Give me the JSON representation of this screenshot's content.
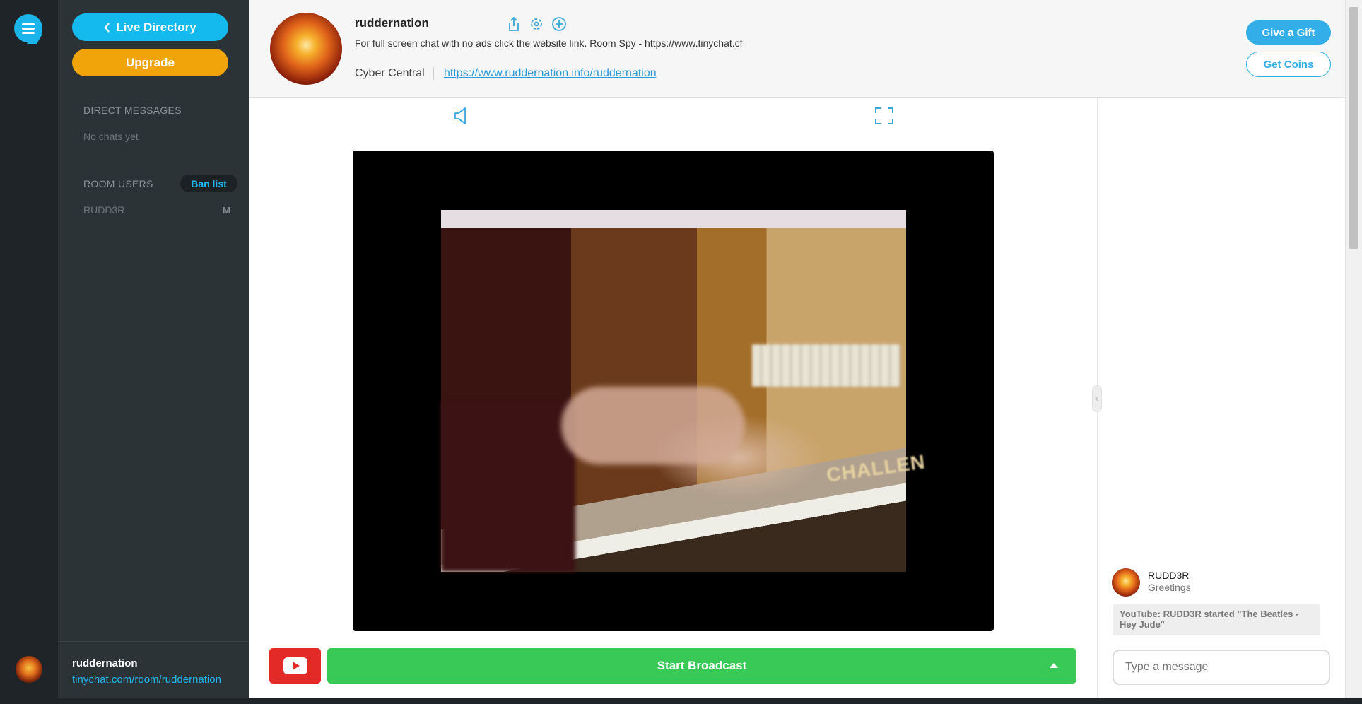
{
  "sidebar": {
    "live_directory_label": "Live Directory",
    "upgrade_label": "Upgrade",
    "direct_messages_heading": "DIRECT MESSAGES",
    "direct_messages_empty": "No chats yet",
    "room_users_heading": "ROOM USERS",
    "ban_list_label": "Ban list",
    "users": [
      {
        "name": "RUDD3R",
        "badge": "M"
      }
    ],
    "footer": {
      "username": "ruddernation",
      "room_url": "tinychat.com/room/ruddernation"
    }
  },
  "header": {
    "room_name": "ruddernation",
    "description": "For full screen chat with no ads click the website link. Room Spy - https://www.tinychat.cf",
    "category": "Cyber Central",
    "website": "https://www.ruddernation.info/ruddernation",
    "give_gift_label": "Give a Gift",
    "get_coins_label": "Get Coins"
  },
  "video": {
    "overlay_text": "CHALLEN"
  },
  "broadcast": {
    "label": "Start Broadcast"
  },
  "chat": {
    "messages": [
      {
        "user": "RUDD3R",
        "text": "Greetings"
      }
    ],
    "system_message": "YouTube: RUDD3R started \"The Beatles - Hey Jude\"",
    "input_placeholder": "Type a message"
  },
  "colors": {
    "accent_blue": "#14b9ee",
    "upgrade_orange": "#f0a40a",
    "broadcast_green": "#38c957",
    "youtube_red": "#e32a26",
    "sidebar_bg": "#2c3337"
  },
  "icons": [
    "chat-logo-icon",
    "chevron-left-icon",
    "share-icon",
    "settings-icon",
    "add-icon",
    "speaker-icon",
    "fullscreen-icon",
    "youtube-icon",
    "chevron-up-icon",
    "collapse-handle-icon"
  ]
}
